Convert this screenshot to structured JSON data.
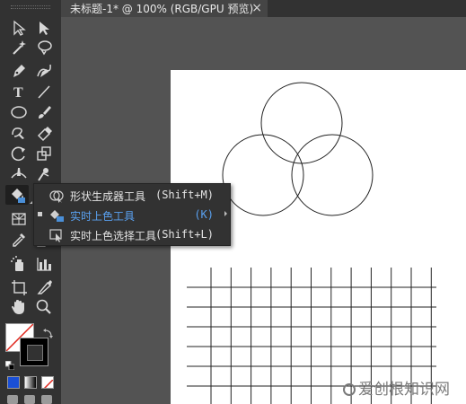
{
  "document_tab": {
    "title": "未标题-1* @ 100% (RGB/GPU 预览)",
    "close_glyph": "×"
  },
  "toolbar": {
    "tools": [
      {
        "name": "selection-tool-icon"
      },
      {
        "name": "direct-selection-tool-icon"
      },
      {
        "name": "magic-wand-tool-icon"
      },
      {
        "name": "lasso-tool-icon"
      },
      {
        "name": "pen-tool-icon"
      },
      {
        "name": "curvature-tool-icon"
      },
      {
        "name": "type-tool-icon"
      },
      {
        "name": "line-segment-tool-icon"
      },
      {
        "name": "ellipse-tool-icon"
      },
      {
        "name": "paintbrush-tool-icon"
      },
      {
        "name": "shaper-tool-icon"
      },
      {
        "name": "eraser-tool-icon"
      },
      {
        "name": "rotate-tool-icon"
      },
      {
        "name": "scale-tool-icon"
      },
      {
        "name": "width-tool-icon"
      },
      {
        "name": "puppet-warp-tool-icon"
      },
      {
        "name": "shape-builder-tool-icon"
      },
      {
        "name": "perspective-grid-tool-icon"
      },
      {
        "name": "eyedropper-tool-icon"
      },
      {
        "name": "symbol-sprayer-tool-icon"
      },
      {
        "name": "column-graph-tool-icon"
      },
      {
        "name": "artboard-tool-icon"
      },
      {
        "name": "slice-tool-icon"
      },
      {
        "name": "hand-tool-icon"
      },
      {
        "name": "zoom-tool-icon"
      }
    ],
    "fill_stroke": {
      "fill": "none",
      "stroke": "#000000"
    },
    "color_modes": [
      "color",
      "gradient",
      "none"
    ],
    "type_glyph": "T"
  },
  "flyout": {
    "items": [
      {
        "label": "形状生成器工具",
        "shortcut": "(Shift+M)",
        "selected": false
      },
      {
        "label": "实时上色工具",
        "shortcut": "(K)",
        "selected": true
      },
      {
        "label": "实时上色选择工具",
        "shortcut": "(Shift+L)",
        "selected": false
      }
    ]
  },
  "colors": {
    "selected_text": "#5aa2f2",
    "app_background": "#535353",
    "panel": "#323232"
  },
  "watermark": {
    "text": "爱创根知识网"
  }
}
